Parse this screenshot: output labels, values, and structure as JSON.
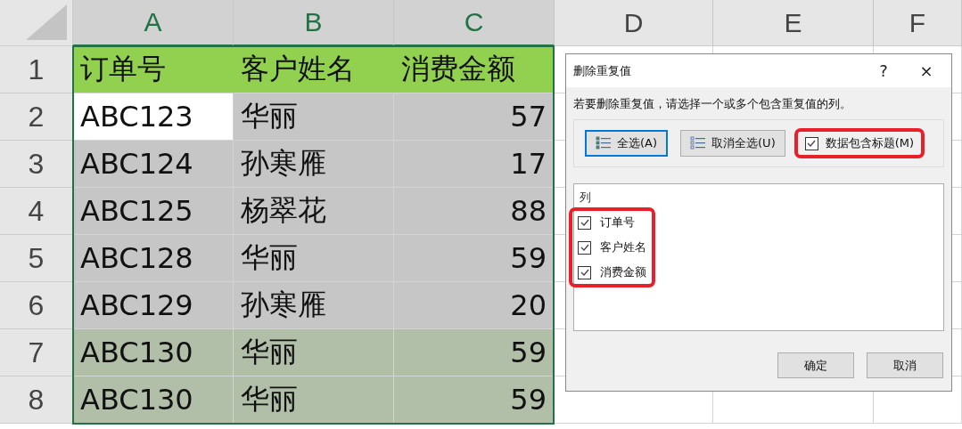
{
  "sheet": {
    "columns": [
      {
        "letter": "A",
        "selected": true,
        "kind": "text"
      },
      {
        "letter": "B",
        "selected": true,
        "kind": "text"
      },
      {
        "letter": "C",
        "selected": true,
        "kind": "number"
      },
      {
        "letter": "D",
        "selected": false,
        "kind": "empty"
      },
      {
        "letter": "E",
        "selected": false,
        "kind": "empty"
      },
      {
        "letter": "F",
        "selected": false,
        "kind": "empty"
      }
    ],
    "rows": [
      {
        "number": "1",
        "kind": "header",
        "cells": [
          {
            "text": "订单号",
            "active": false
          },
          {
            "text": "客户姓名",
            "active": false
          },
          {
            "text": "消费金额",
            "active": false
          }
        ]
      },
      {
        "number": "2",
        "kind": "selected",
        "cells": [
          {
            "text": "ABC123",
            "active": true
          },
          {
            "text": "华丽",
            "active": false
          },
          {
            "text": "57",
            "active": false
          }
        ]
      },
      {
        "number": "3",
        "kind": "selected",
        "cells": [
          {
            "text": "ABC124",
            "active": false
          },
          {
            "text": "孙寒雁",
            "active": false
          },
          {
            "text": "17",
            "active": false
          }
        ]
      },
      {
        "number": "4",
        "kind": "selected",
        "cells": [
          {
            "text": "ABC125",
            "active": false
          },
          {
            "text": "杨翠花",
            "active": false
          },
          {
            "text": "88",
            "active": false
          }
        ]
      },
      {
        "number": "5",
        "kind": "selected",
        "cells": [
          {
            "text": "ABC128",
            "active": false
          },
          {
            "text": "华丽",
            "active": false
          },
          {
            "text": "59",
            "active": false
          }
        ]
      },
      {
        "number": "6",
        "kind": "selected",
        "cells": [
          {
            "text": "ABC129",
            "active": false
          },
          {
            "text": "孙寒雁",
            "active": false
          },
          {
            "text": "20",
            "active": false
          }
        ]
      },
      {
        "number": "7",
        "kind": "duplicate",
        "cells": [
          {
            "text": "ABC130",
            "active": false
          },
          {
            "text": "华丽",
            "active": false
          },
          {
            "text": "59",
            "active": false
          }
        ]
      },
      {
        "number": "8",
        "kind": "duplicate",
        "cells": [
          {
            "text": "ABC130",
            "active": false
          },
          {
            "text": "华丽",
            "active": false
          },
          {
            "text": "59",
            "active": false
          }
        ]
      }
    ]
  },
  "dialog": {
    "title": "删除重复值",
    "help": "?",
    "close": "×",
    "instruction": "若要删除重复值，请选择一个或多个包含重复值的列。",
    "select_all": {
      "label": "全选(A)",
      "focused": true
    },
    "unselect_all": {
      "label": "取消全选(U)",
      "focused": false
    },
    "has_headers": {
      "label": "数据包含标题(M)",
      "checked": true,
      "highlighted": true
    },
    "columns_list": {
      "heading": "列",
      "highlighted": true,
      "items": [
        {
          "label": "订单号",
          "checked": true
        },
        {
          "label": "客户姓名",
          "checked": true
        },
        {
          "label": "消费金额",
          "checked": true
        }
      ]
    },
    "buttons": [
      "确定",
      "取消"
    ]
  }
}
